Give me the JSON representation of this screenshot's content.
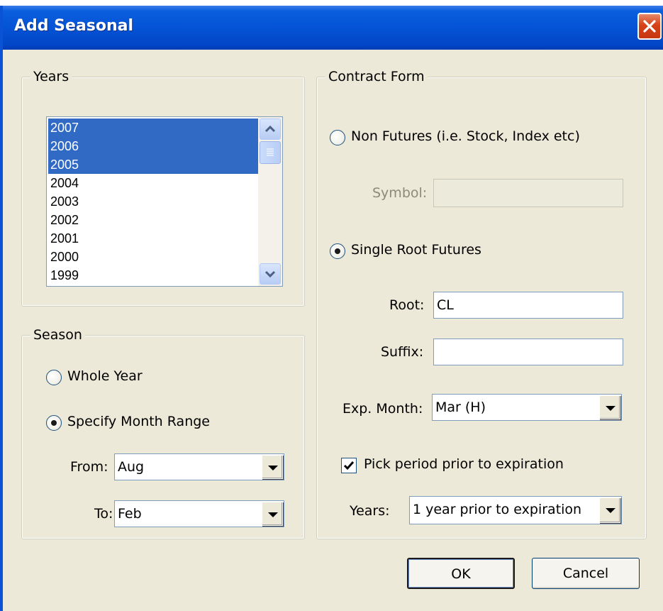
{
  "window": {
    "title": "Add Seasonal",
    "close_icon": "close-icon"
  },
  "years_group": {
    "legend": "Years",
    "items": [
      {
        "label": "2007",
        "selected": true
      },
      {
        "label": "2006",
        "selected": true
      },
      {
        "label": "2005",
        "selected": true
      },
      {
        "label": "2004",
        "selected": false
      },
      {
        "label": "2003",
        "selected": false
      },
      {
        "label": "2002",
        "selected": false
      },
      {
        "label": "2001",
        "selected": false
      },
      {
        "label": "2000",
        "selected": false
      },
      {
        "label": "1999",
        "selected": false
      }
    ]
  },
  "season_group": {
    "legend": "Season",
    "whole_year_label": "Whole Year",
    "whole_year_selected": false,
    "month_range_label": "Specify Month Range",
    "month_range_selected": true,
    "from_label": "From:",
    "from_value": "Aug",
    "to_label": "To:",
    "to_value": "Feb"
  },
  "contract_group": {
    "legend": "Contract Form",
    "non_futures_label": "Non Futures (i.e. Stock, Index etc)",
    "non_futures_selected": false,
    "symbol_label": "Symbol:",
    "symbol_value": "",
    "single_root_label": "Single Root Futures",
    "single_root_selected": true,
    "root_label": "Root:",
    "root_value": "CL",
    "suffix_label": "Suffix:",
    "suffix_value": "",
    "exp_month_label": "Exp. Month:",
    "exp_month_value": "Mar (H)",
    "pick_period_label": "Pick period prior to expiration",
    "pick_period_checked": true,
    "years_label": "Years:",
    "years_value": "1 year prior to expiration"
  },
  "buttons": {
    "ok_label": "OK",
    "cancel_label": "Cancel"
  }
}
